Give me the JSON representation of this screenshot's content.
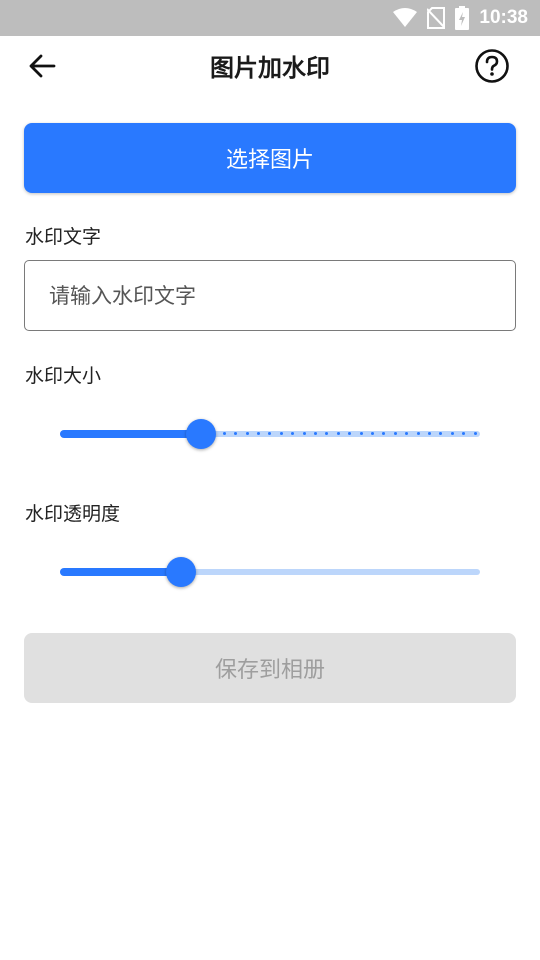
{
  "status_bar": {
    "time": "10:38",
    "icons": [
      "wifi-icon",
      "no-sim-icon",
      "battery-charging-icon"
    ]
  },
  "app_bar": {
    "back_icon": "arrow-left-icon",
    "title": "图片加水印",
    "help_icon": "help-circle-icon"
  },
  "actions": {
    "select_image_label": "选择图片",
    "save_label": "保存到相册",
    "save_enabled": false
  },
  "watermark_text": {
    "label": "水印文字",
    "value": "",
    "placeholder": "请输入水印文字"
  },
  "watermark_size": {
    "label": "水印大小",
    "value_fraction": 0.335,
    "discrete": true
  },
  "watermark_opacity": {
    "label": "水印透明度",
    "value_fraction": 0.287
  },
  "colors": {
    "accent": "#2979ff",
    "accent_light": "#bcd6fb",
    "disabled_bg": "#e0e0e0",
    "disabled_text": "#9e9e9e",
    "status_bar": "#bdbdbd"
  }
}
